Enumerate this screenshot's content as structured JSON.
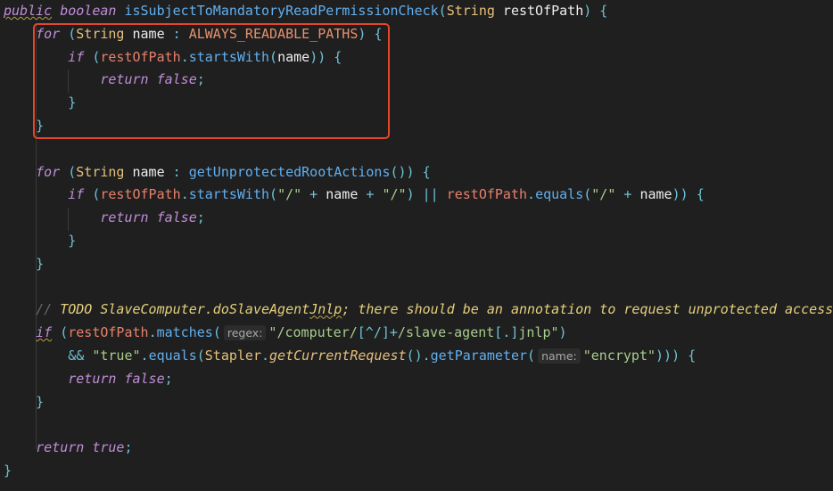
{
  "editor": {
    "lines": [
      [
        [
          "public",
          "kw wv"
        ],
        [
          " "
        ],
        [
          "boolean",
          "kw"
        ],
        [
          " "
        ],
        [
          "isSubjectToMandatoryReadPermissionCheck",
          "fn"
        ],
        [
          "(",
          "pn"
        ],
        [
          "String",
          "ty"
        ],
        [
          " "
        ],
        [
          "restOfPath",
          "id"
        ],
        [
          ")",
          "pn"
        ],
        [
          " "
        ],
        [
          "{",
          "pn"
        ]
      ],
      [
        [
          "    "
        ],
        [
          "for",
          "kw"
        ],
        [
          " "
        ],
        [
          "(",
          "pn"
        ],
        [
          "String",
          "ty"
        ],
        [
          " "
        ],
        [
          "name",
          "id"
        ],
        [
          " : ",
          "op"
        ],
        [
          "ALWAYS_READABLE_PATHS",
          "cn"
        ],
        [
          ")",
          "pn"
        ],
        [
          " "
        ],
        [
          "{",
          "pn"
        ]
      ],
      [
        [
          "        "
        ],
        [
          "if",
          "kw"
        ],
        [
          " "
        ],
        [
          "(",
          "pn"
        ],
        [
          "restOfPath",
          "vr"
        ],
        [
          ".",
          "pn"
        ],
        [
          "startsWith",
          "fn"
        ],
        [
          "(",
          "pn"
        ],
        [
          "name",
          "id"
        ],
        [
          "))",
          "pn"
        ],
        [
          " "
        ],
        [
          "{",
          "pn"
        ]
      ],
      [
        [
          "            "
        ],
        [
          "return",
          "kw"
        ],
        [
          " "
        ],
        [
          "false",
          "kw"
        ],
        [
          ";",
          "pn"
        ]
      ],
      [
        [
          "        "
        ],
        [
          "}",
          "pn"
        ]
      ],
      [
        [
          "    "
        ],
        [
          "}",
          "pn"
        ]
      ],
      [
        [
          " "
        ]
      ],
      [
        [
          "    "
        ],
        [
          "for",
          "kw"
        ],
        [
          " "
        ],
        [
          "(",
          "pn"
        ],
        [
          "String",
          "ty"
        ],
        [
          " "
        ],
        [
          "name",
          "id"
        ],
        [
          " : ",
          "op"
        ],
        [
          "getUnprotectedRootActions",
          "fn"
        ],
        [
          "())",
          "pn"
        ],
        [
          " "
        ],
        [
          "{",
          "pn"
        ]
      ],
      [
        [
          "        "
        ],
        [
          "if",
          "kw"
        ],
        [
          " "
        ],
        [
          "(",
          "pn"
        ],
        [
          "restOfPath",
          "vr"
        ],
        [
          ".",
          "pn"
        ],
        [
          "startsWith",
          "fn"
        ],
        [
          "(",
          "pn"
        ],
        [
          "\"/\"",
          "st"
        ],
        [
          " + ",
          "op"
        ],
        [
          "name",
          "id"
        ],
        [
          " + ",
          "op"
        ],
        [
          "\"/\"",
          "st"
        ],
        [
          ")",
          "pn"
        ],
        [
          " || ",
          "op"
        ],
        [
          "restOfPath",
          "vr"
        ],
        [
          ".",
          "pn"
        ],
        [
          "equals",
          "fn"
        ],
        [
          "(",
          "pn"
        ],
        [
          "\"/\"",
          "st"
        ],
        [
          " + ",
          "op"
        ],
        [
          "name",
          "id"
        ],
        [
          "))",
          "pn"
        ],
        [
          " "
        ],
        [
          "{",
          "pn"
        ]
      ],
      [
        [
          "            "
        ],
        [
          "return",
          "kw"
        ],
        [
          " "
        ],
        [
          "false",
          "kw"
        ],
        [
          ";",
          "pn"
        ]
      ],
      [
        [
          "        "
        ],
        [
          "}",
          "pn"
        ]
      ],
      [
        [
          "    "
        ],
        [
          "}",
          "pn"
        ]
      ],
      [
        [
          " "
        ]
      ],
      [
        [
          "    "
        ],
        [
          "// ",
          "cm"
        ],
        [
          "TODO SlaveComputer.doSlaveAgent",
          "td"
        ],
        [
          "Jnlp",
          "td wv"
        ],
        [
          "; there should be an annotation to request unprotected access",
          "td"
        ]
      ],
      [
        [
          "    "
        ],
        [
          "if",
          "kw wv"
        ],
        [
          " "
        ],
        [
          "(",
          "pn"
        ],
        [
          "restOfPath",
          "vr"
        ],
        [
          ".",
          "pn"
        ],
        [
          "matches",
          "fn"
        ],
        [
          "(",
          "pn"
        ],
        [
          "regex:",
          "hint"
        ],
        [
          "\"/computer/",
          "st"
        ],
        [
          "[^/]",
          "pn"
        ],
        [
          "+",
          "op"
        ],
        [
          "/slave-agent",
          "st"
        ],
        [
          "[.]",
          "pn"
        ],
        [
          "jnlp\"",
          "st"
        ],
        [
          ")",
          "pn"
        ]
      ],
      [
        [
          "        "
        ],
        [
          "&&",
          "op"
        ],
        [
          " "
        ],
        [
          "\"true\"",
          "st"
        ],
        [
          ".",
          "pn"
        ],
        [
          "equals",
          "fn"
        ],
        [
          "(",
          "pn"
        ],
        [
          "Stapler",
          "ty"
        ],
        [
          ".",
          "pn"
        ],
        [
          "getCurrentRequest",
          "fi"
        ],
        [
          "().",
          "pn"
        ],
        [
          "getParameter",
          "fn"
        ],
        [
          "(",
          "pn"
        ],
        [
          "name:",
          "hint"
        ],
        [
          "\"encrypt\"",
          "st"
        ],
        [
          ")))",
          "pn"
        ],
        [
          " "
        ],
        [
          "{",
          "pn"
        ]
      ],
      [
        [
          "        "
        ],
        [
          "return",
          "kw"
        ],
        [
          " "
        ],
        [
          "false",
          "kw"
        ],
        [
          ";",
          "pn"
        ]
      ],
      [
        [
          "    "
        ],
        [
          "}",
          "pn"
        ]
      ],
      [
        [
          " "
        ]
      ],
      [
        [
          "    "
        ],
        [
          "return",
          "kw"
        ],
        [
          " "
        ],
        [
          "true",
          "kw"
        ],
        [
          ";",
          "pn"
        ]
      ],
      [
        [
          "}",
          "pn"
        ]
      ]
    ]
  },
  "colors": {
    "highlight_box": "#e3462a",
    "background": "#1f1f1f"
  }
}
